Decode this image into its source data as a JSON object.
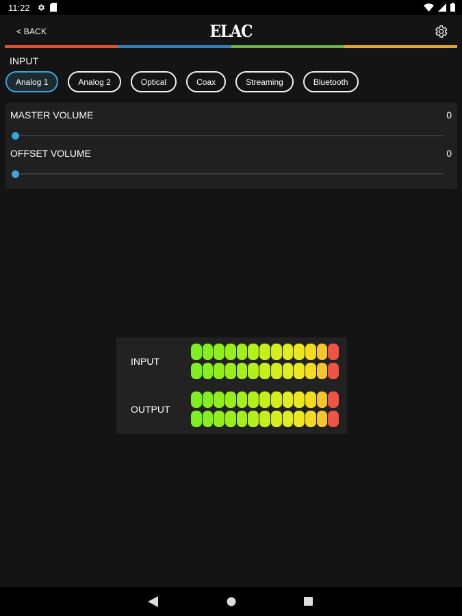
{
  "status_bar": {
    "time": "11:22",
    "left_icons": [
      "gear-icon",
      "sd-card-icon"
    ],
    "right_icons": [
      "wifi-icon",
      "signal-icon",
      "battery-icon"
    ]
  },
  "header": {
    "back_label": "< BACK",
    "logo_text": "ELAC",
    "settings_icon": "gear-icon",
    "color_stripe": [
      "#e0522a",
      "#2f7ec1",
      "#6db33f",
      "#e6a623"
    ]
  },
  "input": {
    "section_label": "INPUT",
    "options": [
      "Analog 1",
      "Analog 2",
      "Optical",
      "Coax",
      "Streaming",
      "Bluetooth"
    ],
    "selected": "Analog 1",
    "accent": "#39a6d8"
  },
  "volume": {
    "master": {
      "label": "MASTER VOLUME",
      "value": "0",
      "level": 0
    },
    "offset": {
      "label": "OFFSET VOLUME",
      "value": "0",
      "level": 0
    }
  },
  "meters": {
    "input_label": "INPUT",
    "output_label": "OUTPUT",
    "segments_per_row": 13,
    "segment_colors": [
      "#7ef021",
      "#86ef1e",
      "#8fee1c",
      "#98ee1a",
      "#a3ef1a",
      "#b3ef1a",
      "#c5ef1a",
      "#d3ee1b",
      "#e0ee1e",
      "#ebe820",
      "#f2dc22",
      "#f6c52a",
      "#f05343"
    ]
  },
  "nav": {
    "back_icon": "nav-back-icon",
    "home_icon": "nav-home-icon",
    "recents_icon": "nav-recents-icon"
  }
}
